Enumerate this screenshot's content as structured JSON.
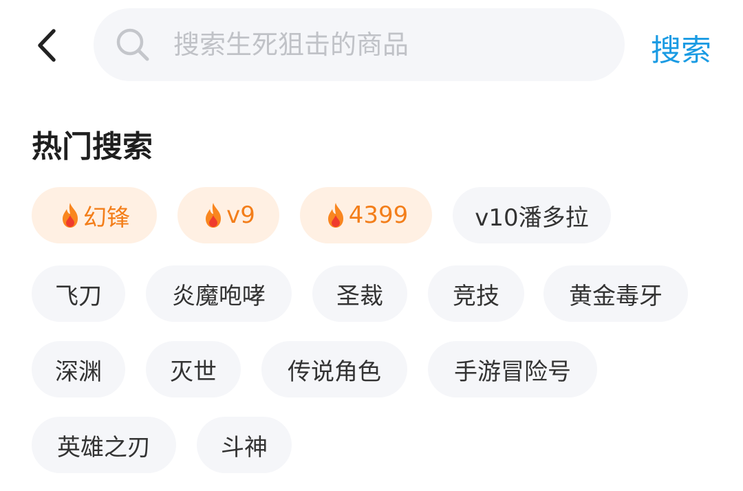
{
  "search": {
    "placeholder": "搜索生死狙击的商品",
    "value": "",
    "submit_label": "搜索"
  },
  "hot_search": {
    "title": "热门搜索",
    "tags": [
      {
        "label": "幻锋",
        "hot": true
      },
      {
        "label": "v9",
        "hot": true
      },
      {
        "label": "4399",
        "hot": true
      },
      {
        "label": "v10潘多拉",
        "hot": false
      },
      {
        "label": "飞刀",
        "hot": false
      },
      {
        "label": "炎魔咆哮",
        "hot": false
      },
      {
        "label": "圣裁",
        "hot": false
      },
      {
        "label": "竞技",
        "hot": false
      },
      {
        "label": "黄金毒牙",
        "hot": false
      },
      {
        "label": "深渊",
        "hot": false
      },
      {
        "label": "灭世",
        "hot": false
      },
      {
        "label": "传说角色",
        "hot": false
      },
      {
        "label": "手游冒险号",
        "hot": false
      },
      {
        "label": "英雄之刃",
        "hot": false
      },
      {
        "label": "斗神",
        "hot": false
      }
    ]
  },
  "icons": {
    "back": "chevron-left-icon",
    "search": "search-icon",
    "hot": "fire-icon"
  },
  "colors": {
    "accent": "#1a9be3",
    "hot_text": "#f37e1a",
    "hot_bg": "#fff0e3",
    "tag_bg": "#f5f6f9"
  }
}
